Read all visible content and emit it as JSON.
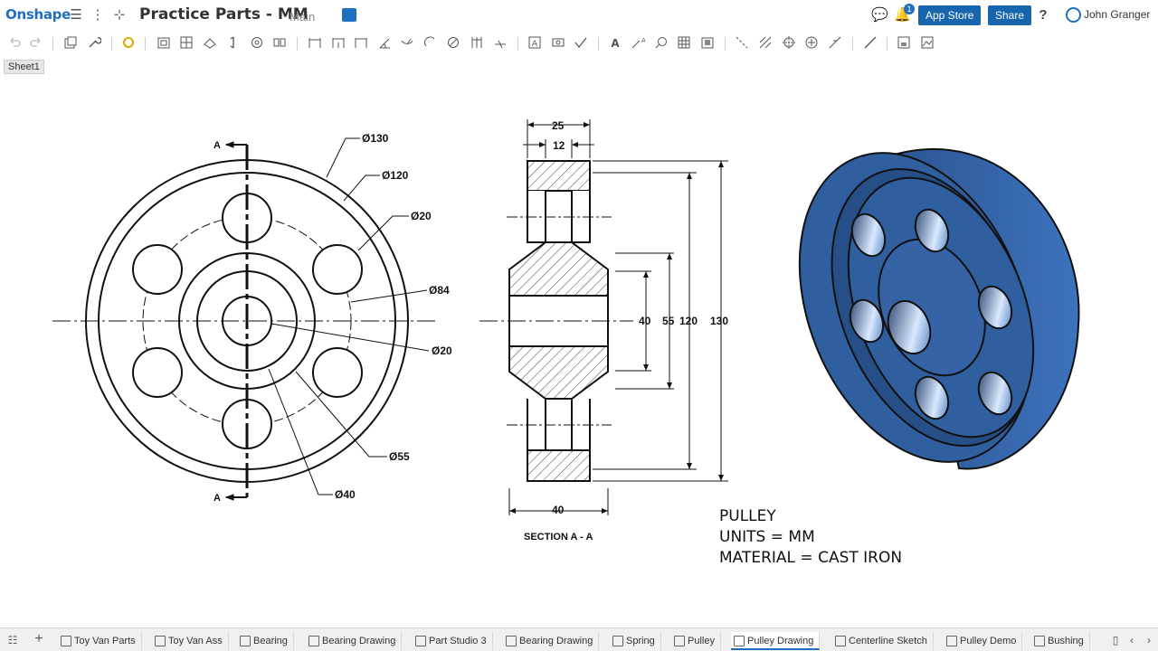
{
  "app": {
    "logo": "Onshape"
  },
  "document": {
    "title": "Practice Parts - MM",
    "branch": "Main"
  },
  "header": {
    "app_store_label": "App Store",
    "share_label": "Share",
    "help_label": "?",
    "notification_count": "1",
    "user_name": "John Granger"
  },
  "sheet": {
    "tab_label": "Sheet1"
  },
  "drawing": {
    "front_view": {
      "section_marker_top": "A",
      "section_marker_bottom": "A",
      "dims": [
        "Ø130",
        "Ø120",
        "Ø20",
        "Ø84",
        "Ø20",
        "Ø55",
        "Ø40"
      ]
    },
    "section_view": {
      "top_dims": [
        "25",
        "12"
      ],
      "bottom_dim": "40",
      "side_dims": [
        "40",
        "55",
        "120",
        "130"
      ],
      "caption": "SECTION A - A"
    },
    "title_block": {
      "line1": "PULLEY",
      "line2": "UNITS = MM",
      "line3": "MATERIAL = CAST IRON"
    },
    "part_color": "#2f5f9e"
  },
  "bottom_tabs": [
    {
      "label": "Toy Van Parts",
      "type": "part-studio"
    },
    {
      "label": "Toy Van Ass",
      "type": "assembly"
    },
    {
      "label": "Bearing",
      "type": "part-studio"
    },
    {
      "label": "Bearing Drawing",
      "type": "drawing"
    },
    {
      "label": "Part Studio 3",
      "type": "part-studio"
    },
    {
      "label": "Bearing Drawing",
      "type": "drawing"
    },
    {
      "label": "Spring",
      "type": "part-studio"
    },
    {
      "label": "Pulley",
      "type": "part-studio"
    },
    {
      "label": "Pulley Drawing",
      "type": "drawing",
      "active": true
    },
    {
      "label": "Centerline Sketch",
      "type": "part-studio"
    },
    {
      "label": "Pulley Demo",
      "type": "part-studio"
    },
    {
      "label": "Bushing",
      "type": "part-studio"
    }
  ],
  "colors": {
    "accent": "#1f6ebf",
    "button": "#1765ad"
  }
}
